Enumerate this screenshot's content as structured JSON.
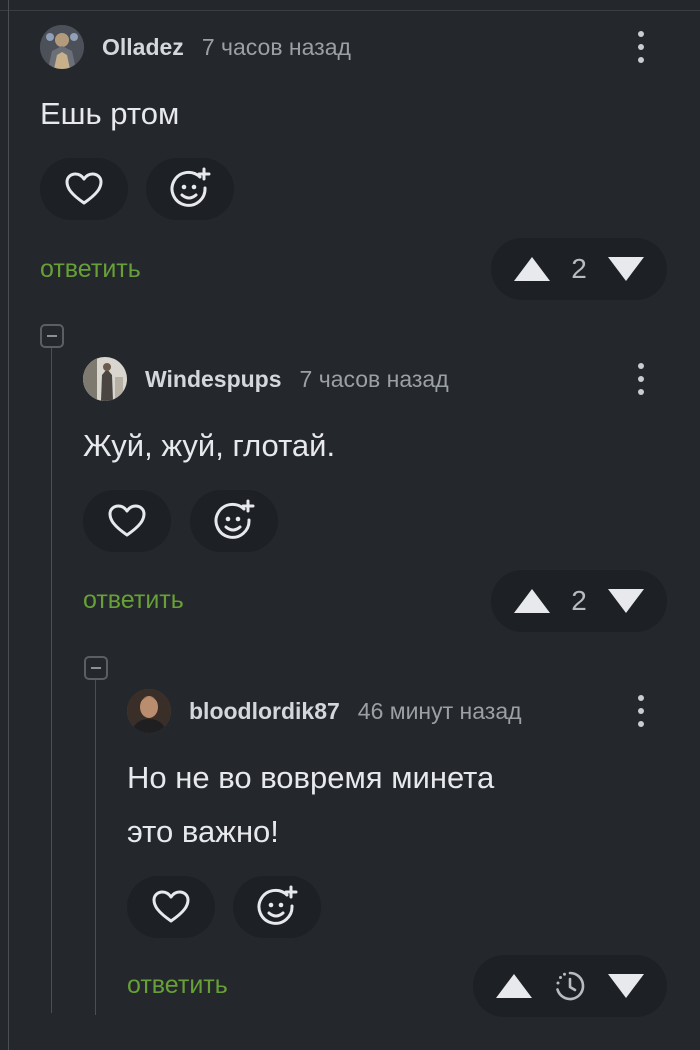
{
  "colors": {
    "background": "#24272b",
    "pill": "#1d2024",
    "reply_green": "#67a037",
    "text": "#e7e9ec",
    "muted": "#9aa0a6"
  },
  "comments": [
    {
      "username": "Olladez",
      "time": "7 часов назад",
      "text": "Ешь ртом",
      "reply_label": "ответить",
      "rating": "2",
      "icons": {
        "like": "heart-icon",
        "react": "smiley-add-icon",
        "up": "arrow-up-icon",
        "down": "arrow-down-icon",
        "more": "more-vertical-icon"
      }
    },
    {
      "username": "Windespups",
      "time": "7 часов назад",
      "text": "Жуй, жуй, глотай.",
      "reply_label": "ответить",
      "rating": "2",
      "icons": {
        "like": "heart-icon",
        "react": "smiley-add-icon",
        "up": "arrow-up-icon",
        "down": "arrow-down-icon",
        "more": "more-vertical-icon"
      }
    },
    {
      "username": "bloodlordik87",
      "time": "46 минут назад",
      "text": "Но не во вовремя минета\nэто важно!",
      "reply_label": "ответить",
      "rating_icon": "clock-pending-icon",
      "icons": {
        "like": "heart-icon",
        "react": "smiley-add-icon",
        "up": "arrow-up-icon",
        "down": "arrow-down-icon",
        "more": "more-vertical-icon"
      }
    }
  ]
}
